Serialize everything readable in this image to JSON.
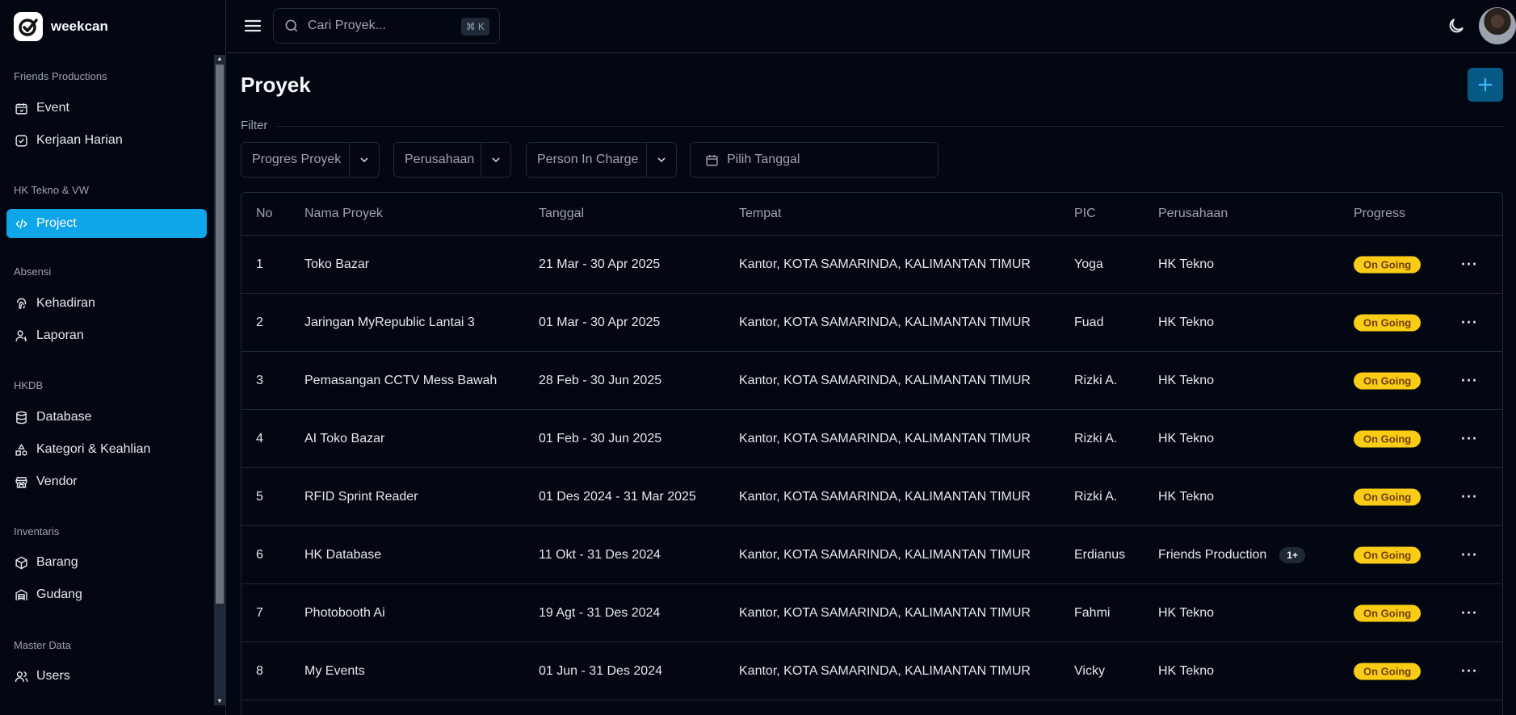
{
  "brand": {
    "name": "weekcan"
  },
  "sidebar": {
    "groups": [
      {
        "label": "Friends Productions",
        "items": [
          {
            "label": "Event",
            "icon": "calendar-icon"
          },
          {
            "label": "Kerjaan Harian",
            "icon": "task-icon"
          }
        ]
      },
      {
        "label": "HK Tekno & VW",
        "items": [
          {
            "label": "Project",
            "icon": "code-icon",
            "active": true
          }
        ]
      },
      {
        "label": "Absensi",
        "items": [
          {
            "label": "Kehadiran",
            "icon": "fingerprint-icon"
          },
          {
            "label": "Laporan",
            "icon": "user-report-icon"
          }
        ]
      },
      {
        "label": "HKDB",
        "items": [
          {
            "label": "Database",
            "icon": "database-icon"
          },
          {
            "label": "Kategori & Keahlian",
            "icon": "shapes-icon"
          },
          {
            "label": "Vendor",
            "icon": "store-icon"
          }
        ]
      },
      {
        "label": "Inventaris",
        "items": [
          {
            "label": "Barang",
            "icon": "box-icon"
          },
          {
            "label": "Gudang",
            "icon": "warehouse-icon"
          }
        ]
      },
      {
        "label": "Master Data",
        "items": [
          {
            "label": "Users",
            "icon": "users-icon"
          }
        ]
      }
    ]
  },
  "topbar": {
    "search_placeholder": "Cari Proyek...",
    "shortcut": "⌘ K"
  },
  "page": {
    "title": "Proyek",
    "filter_label": "Filter",
    "filters": [
      "Progres Proyek",
      "Perusahaan",
      "Person In Charge"
    ],
    "date_placeholder": "Pilih Tanggal"
  },
  "table": {
    "headers": [
      "No",
      "Nama Proyek",
      "Tanggal",
      "Tempat",
      "PIC",
      "Perusahaan",
      "Progress"
    ],
    "rows": [
      {
        "no": "1",
        "name": "Toko Bazar",
        "date": "21 Mar - 30 Apr 2025",
        "place": "Kantor, KOTA SAMARINDA, KALIMANTAN TIMUR",
        "pic": "Yoga",
        "company": "HK Tekno",
        "extra": "",
        "progress": "On Going"
      },
      {
        "no": "2",
        "name": "Jaringan MyRepublic Lantai 3",
        "date": "01 Mar - 30 Apr 2025",
        "place": "Kantor, KOTA SAMARINDA, KALIMANTAN TIMUR",
        "pic": "Fuad",
        "company": "HK Tekno",
        "extra": "",
        "progress": "On Going"
      },
      {
        "no": "3",
        "name": "Pemasangan CCTV Mess Bawah",
        "date": "28 Feb - 30 Jun 2025",
        "place": "Kantor, KOTA SAMARINDA, KALIMANTAN TIMUR",
        "pic": "Rizki A.",
        "company": "HK Tekno",
        "extra": "",
        "progress": "On Going"
      },
      {
        "no": "4",
        "name": "AI Toko Bazar",
        "date": "01 Feb - 30 Jun 2025",
        "place": "Kantor, KOTA SAMARINDA, KALIMANTAN TIMUR",
        "pic": "Rizki A.",
        "company": "HK Tekno",
        "extra": "",
        "progress": "On Going"
      },
      {
        "no": "5",
        "name": "RFID Sprint Reader",
        "date": "01 Des 2024 - 31 Mar 2025",
        "place": "Kantor, KOTA SAMARINDA, KALIMANTAN TIMUR",
        "pic": "Rizki A.",
        "company": "HK Tekno",
        "extra": "",
        "progress": "On Going"
      },
      {
        "no": "6",
        "name": "HK Database",
        "date": "11 Okt - 31 Des 2024",
        "place": "Kantor, KOTA SAMARINDA, KALIMANTAN TIMUR",
        "pic": "Erdianus",
        "company": "Friends Production",
        "extra": "1+",
        "progress": "On Going"
      },
      {
        "no": "7",
        "name": "Photobooth Ai",
        "date": "19 Agt - 31 Des 2024",
        "place": "Kantor, KOTA SAMARINDA, KALIMANTAN TIMUR",
        "pic": "Fahmi",
        "company": "HK Tekno",
        "extra": "",
        "progress": "On Going"
      },
      {
        "no": "8",
        "name": "My Events",
        "date": "01 Jun - 31 Des 2024",
        "place": "Kantor, KOTA SAMARINDA, KALIMANTAN TIMUR",
        "pic": "Vicky",
        "company": "HK Tekno",
        "extra": "",
        "progress": "On Going"
      }
    ]
  },
  "colors": {
    "background": "#030712",
    "active": "#0ea5e9",
    "badge": "#facc15",
    "add_button": "#075985"
  }
}
